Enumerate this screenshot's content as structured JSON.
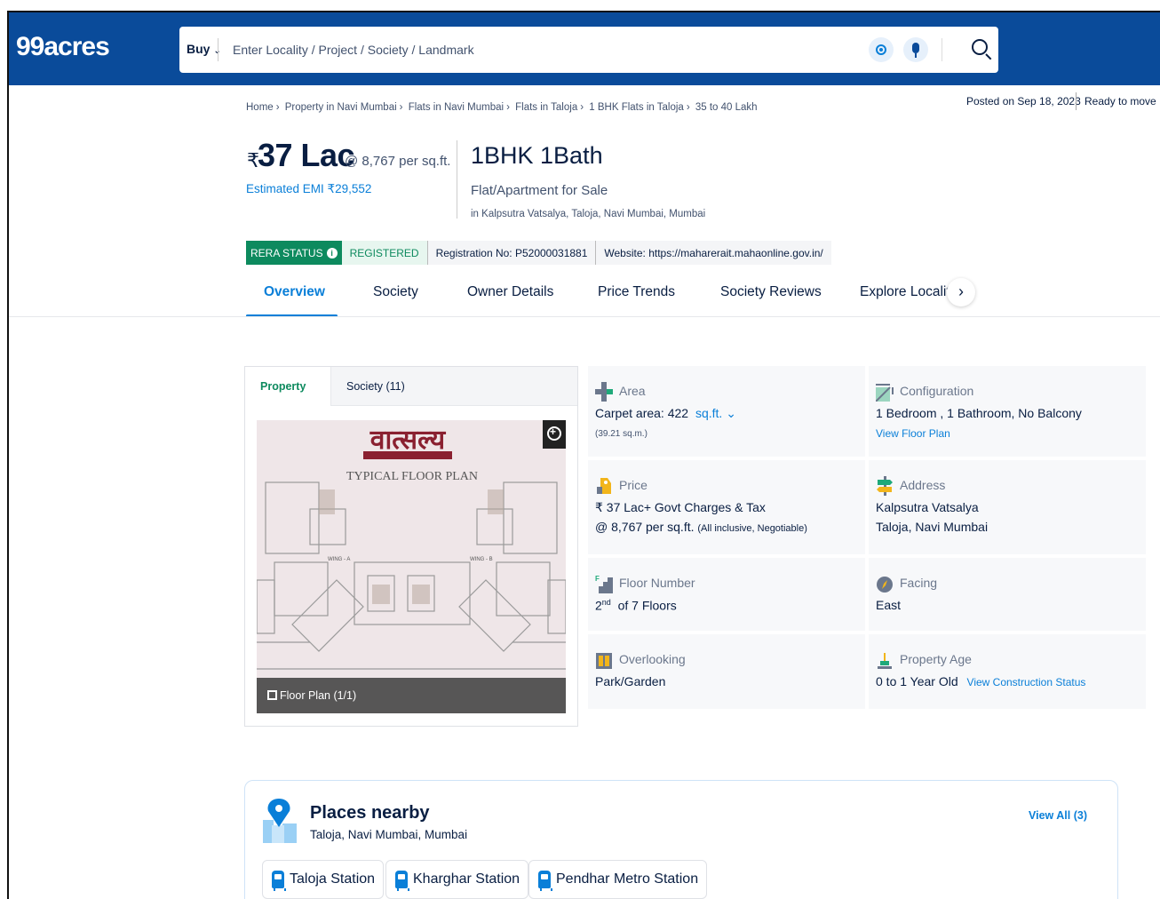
{
  "header": {
    "logo": "99acres",
    "search": {
      "mode": "Buy",
      "placeholder": "Enter Locality / Project / Society / Landmark"
    }
  },
  "posted": {
    "date": "Posted on Sep 18, 2023",
    "status": "Ready to move"
  },
  "breadcrumb": [
    "Home",
    "Property in Navi Mumbai",
    "Flats in Navi Mumbai",
    "Flats in Taloja",
    "1 BHK Flats in Taloja",
    "35 to 40 Lakh"
  ],
  "price": {
    "currency": "₹",
    "amount": "37 Lac",
    "per_sqft": "@ 8,767 per sq.ft.",
    "emi": "Estimated EMI ₹29,552"
  },
  "summary": {
    "config": "1BHK 1Bath",
    "type": "Flat/Apartment for Sale",
    "location": "in Kalpsutra Vatsalya, Taloja, Navi Mumbai, Mumbai"
  },
  "rera": {
    "label": "RERA STATUS",
    "status": "REGISTERED",
    "registration": "Registration No: P52000031881",
    "website": "Website: https://maharerait.mahaonline.gov.in/"
  },
  "tabs": [
    "Overview",
    "Society",
    "Owner Details",
    "Price Trends",
    "Society Reviews",
    "Explore Locality"
  ],
  "gallery": {
    "tabs": [
      "Property (1)",
      "Society (11)"
    ],
    "plan_title": "वात्सल्य",
    "plan_subtitle": "TYPICAL FLOOR PLAN",
    "caption": "Floor Plan (1/1)"
  },
  "details": {
    "area": {
      "label": "Area",
      "value": "Carpet area: 422",
      "unit": "sq.ft.",
      "sub": "(39.21 sq.m.)"
    },
    "configuration": {
      "label": "Configuration",
      "value": "1 Bedroom , 1 Bathroom, No Balcony",
      "link": "View Floor Plan"
    },
    "price": {
      "label": "Price",
      "value": "₹ 37 Lac+ Govt Charges & Tax",
      "sub": "@ 8,767 per sq.ft.",
      "note": "(All inclusive, Negotiable)"
    },
    "address": {
      "label": "Address",
      "line1": "Kalpsutra Vatsalya",
      "line2": "Taloja, Navi Mumbai"
    },
    "floor": {
      "label": "Floor Number",
      "floor": "2",
      "suffix": "nd",
      "of": "of 7 Floors"
    },
    "facing": {
      "label": "Facing",
      "value": "East"
    },
    "overlooking": {
      "label": "Overlooking",
      "value": "Park/Garden"
    },
    "age": {
      "label": "Property Age",
      "value": "0 to 1 Year Old",
      "link": "View Construction Status"
    }
  },
  "places": {
    "title": "Places nearby",
    "subtitle": "Taloja, Navi Mumbai, Mumbai",
    "view_all": "View All (3)",
    "items": [
      "Taloja Station",
      "Kharghar Station",
      "Pendhar Metro Station"
    ]
  },
  "colors": {
    "brand": "#0a4b9a",
    "accent": "#0a7fd8",
    "rera_green": "#0d8a5e"
  }
}
